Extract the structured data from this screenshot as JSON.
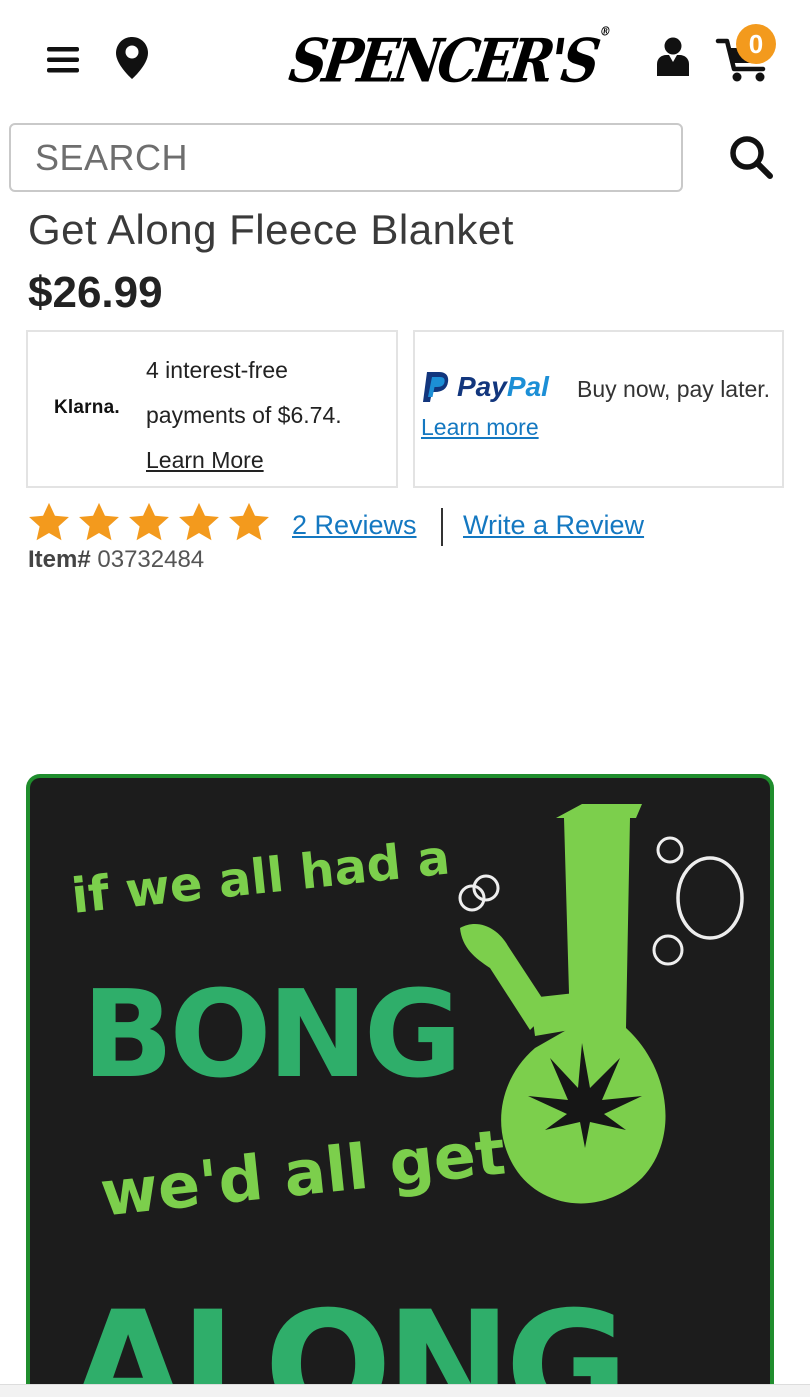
{
  "header": {
    "logo_text": "SPENCER'S",
    "logo_mark": "®",
    "cart_count": "0",
    "icons": [
      "menu-icon",
      "location-pin-icon",
      "account-icon",
      "cart-icon",
      "search-icon"
    ]
  },
  "search": {
    "placeholder": "SEARCH"
  },
  "product": {
    "title": "Get Along Fleece Blanket",
    "price": "$26.99",
    "item_label": "Item#",
    "item_number": "03732484"
  },
  "klarna": {
    "logo": "Klarna.",
    "line1": "4 interest-free",
    "line2": "payments of $6.74.",
    "learn_more": "Learn More"
  },
  "paypal": {
    "logo_pay": "Pay",
    "logo_pal": "Pal",
    "tagline": "Buy now, pay later.",
    "learn_more": "Learn more"
  },
  "ratings": {
    "rating": 5,
    "max_rating": 5,
    "reviews_label": "2 Reviews",
    "write_review": "Write a Review"
  },
  "image": {
    "line1": "if we all had a",
    "line2": "BONG",
    "line3": "we'd all get",
    "line4": "ALONG"
  },
  "colors": {
    "star": "#f39a1d",
    "link": "#1478c1",
    "badge": "#f39a1d",
    "blanket_green": "#2fae6a",
    "blanket_light_green": "#7ccf4c"
  }
}
